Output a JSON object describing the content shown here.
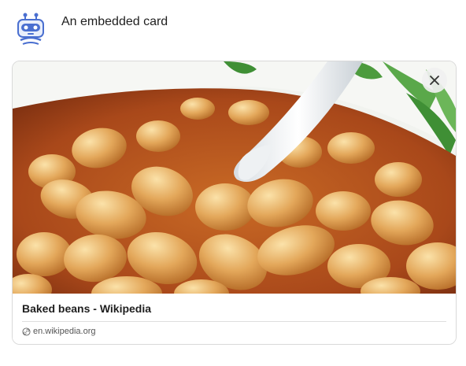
{
  "header": {
    "title": "An embedded card",
    "avatar_icon": "robot-icon"
  },
  "card": {
    "image_icon": "baked-beans-photo",
    "close_icon": "close-icon",
    "title": "Baked beans - Wikipedia",
    "source": "en.wikipedia.org",
    "source_icon": "link-icon"
  },
  "colors": {
    "avatar_blue": "#4a6fd0",
    "avatar_light": "#e8eefb",
    "sauce": "#b9541b",
    "bean": "#e9b76f",
    "bowl": "#f4f6f2"
  }
}
